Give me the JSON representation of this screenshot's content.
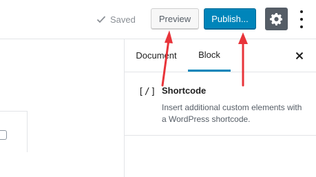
{
  "header": {
    "saved_label": "Saved",
    "preview_label": "Preview",
    "publish_label": "Publish...",
    "settings_icon": "gear-icon",
    "more_icon": "more-vertical-icon"
  },
  "sidebar": {
    "tabs": [
      {
        "label": "Document",
        "active": false
      },
      {
        "label": "Block",
        "active": true
      }
    ],
    "close_icon": "close-icon",
    "block": {
      "icon_text": "[/]",
      "title": "Shortcode",
      "description": "Insert additional custom elements with a WordPress shortcode."
    }
  },
  "colors": {
    "accent": "#0085ba",
    "annotation": "#e8343a",
    "settings_bg": "#555d66"
  }
}
